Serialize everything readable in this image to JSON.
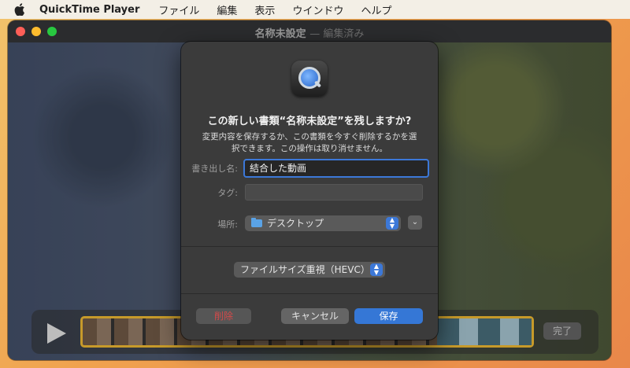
{
  "menubar": {
    "app_name": "QuickTime Player",
    "menus": [
      "ファイル",
      "編集",
      "表示",
      "ウインドウ",
      "ヘルプ"
    ]
  },
  "window": {
    "title": "名称未設定",
    "edited": "— 編集済み"
  },
  "trimbar": {
    "done_label": "完了"
  },
  "dialog": {
    "title": "この新しい書類“名称未設定”を残しますか?",
    "message": "変更内容を保存するか、この書類を今すぐ削除するかを選択できます。この操作は取り消せません。",
    "save_as_label": "書き出し名:",
    "save_as_value": "結合した動画",
    "tags_label": "タグ:",
    "where_label": "場所:",
    "where_value": "デスクトップ",
    "format_value": "ファイルサイズ重視（HEVC）",
    "delete_label": "削除",
    "cancel_label": "キャンセル",
    "save_label": "保存"
  }
}
